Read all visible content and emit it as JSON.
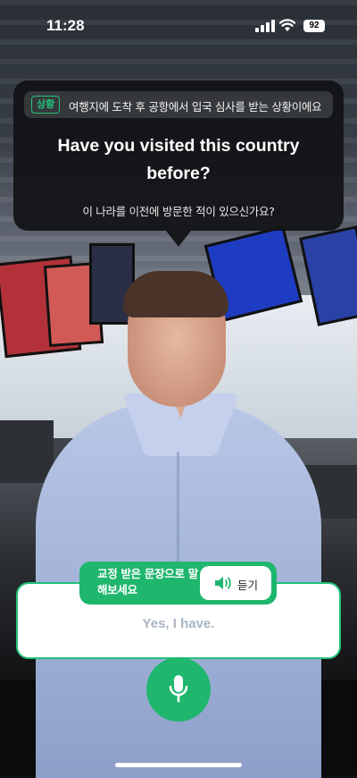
{
  "status_bar": {
    "time": "11:28",
    "battery": "92"
  },
  "question_card": {
    "situation_badge": "상황",
    "situation_text": "여행지에 도착 후 공항에서 입국 심사를 받는 상황이에요",
    "question_en": "Have you visited this country before?",
    "question_ko": "이 나라를 이전에 방문한 적이 있으신가요?"
  },
  "answer_area": {
    "prompt": "교정 받은 문장으로 말해보세요",
    "listen_label": "듣기",
    "answer": "Yes, I have."
  },
  "colors": {
    "accent": "#1fb66d",
    "card_bg": "#111215",
    "answer_text": "#a9b4c2"
  },
  "icons": {
    "signal": "signal-icon",
    "wifi": "wifi-icon",
    "speaker": "speaker-icon",
    "mic": "mic-icon"
  }
}
